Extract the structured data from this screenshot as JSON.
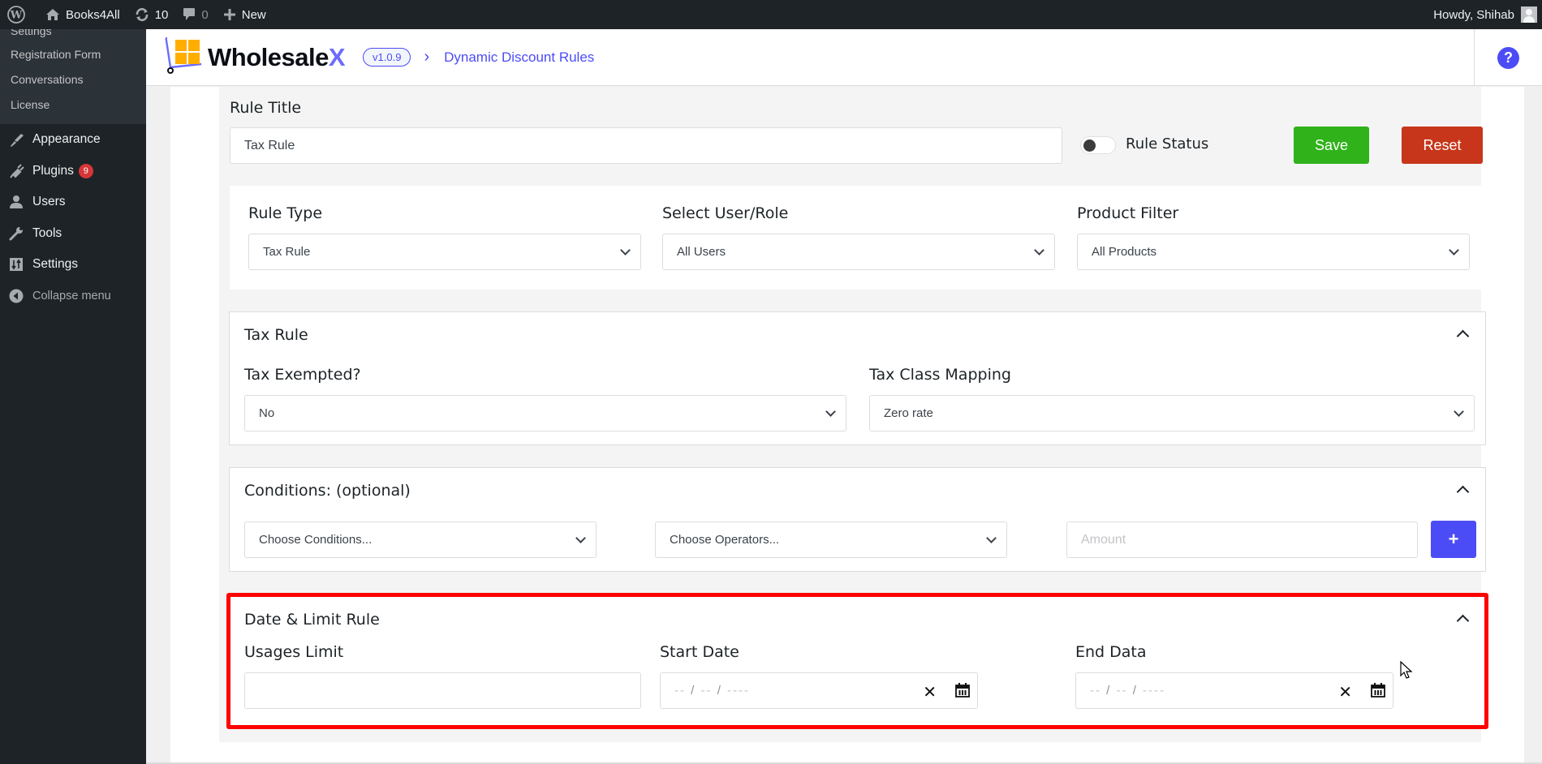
{
  "admin_bar": {
    "site_name": "Books4All",
    "updates_count": "10",
    "comments_count": "0",
    "new_label": "New",
    "greeting": "Howdy, Shihab"
  },
  "sidebar": {
    "submenu": [
      {
        "label": "Settings"
      },
      {
        "label": "Registration Form"
      },
      {
        "label": "Conversations"
      },
      {
        "label": "License"
      }
    ],
    "items": [
      {
        "label": "Appearance",
        "icon": "paintbrush-icon"
      },
      {
        "label": "Plugins",
        "icon": "plugin-icon",
        "badge": "9"
      },
      {
        "label": "Users",
        "icon": "users-icon"
      },
      {
        "label": "Tools",
        "icon": "wrench-icon"
      },
      {
        "label": "Settings",
        "icon": "settings-icon"
      }
    ],
    "collapse_label": "Collapse menu"
  },
  "header": {
    "brand_main": "Wholesale",
    "brand_accent": "X",
    "version": "v1.0.9",
    "breadcrumb": "Dynamic Discount Rules",
    "help_icon": "?"
  },
  "rule": {
    "title_label": "Rule Title",
    "title_value": "Tax Rule",
    "status_label": "Rule Status",
    "status_on": false,
    "save_label": "Save",
    "reset_label": "Reset"
  },
  "filters": {
    "rule_type_label": "Rule Type",
    "rule_type_value": "Tax Rule",
    "user_role_label": "Select User/Role",
    "user_role_value": "All Users",
    "product_filter_label": "Product Filter",
    "product_filter_value": "All Products"
  },
  "tax_rule": {
    "title": "Tax Rule",
    "exempted_label": "Tax Exempted?",
    "exempted_value": "No",
    "class_mapping_label": "Tax Class Mapping",
    "class_mapping_value": "Zero rate"
  },
  "conditions": {
    "title": "Conditions: (optional)",
    "conditions_value": "Choose Conditions...",
    "operators_value": "Choose Operators...",
    "amount_placeholder": "Amount",
    "add_label": "+"
  },
  "date_limit": {
    "title": "Date & Limit Rule",
    "usage_limit_label": "Usages Limit",
    "usage_limit_value": "",
    "start_date_label": "Start Date",
    "end_date_label": "End Data",
    "date_placeholder_dd": "--",
    "date_placeholder_mm": "--",
    "date_placeholder_yyyy": "----",
    "clear_icon": "✕"
  },
  "colors": {
    "accent": "#4c4cf7",
    "save": "#2fb21a",
    "reset": "#c7361a",
    "highlight": "#ff0000",
    "admin_bar": "#1d2327"
  }
}
